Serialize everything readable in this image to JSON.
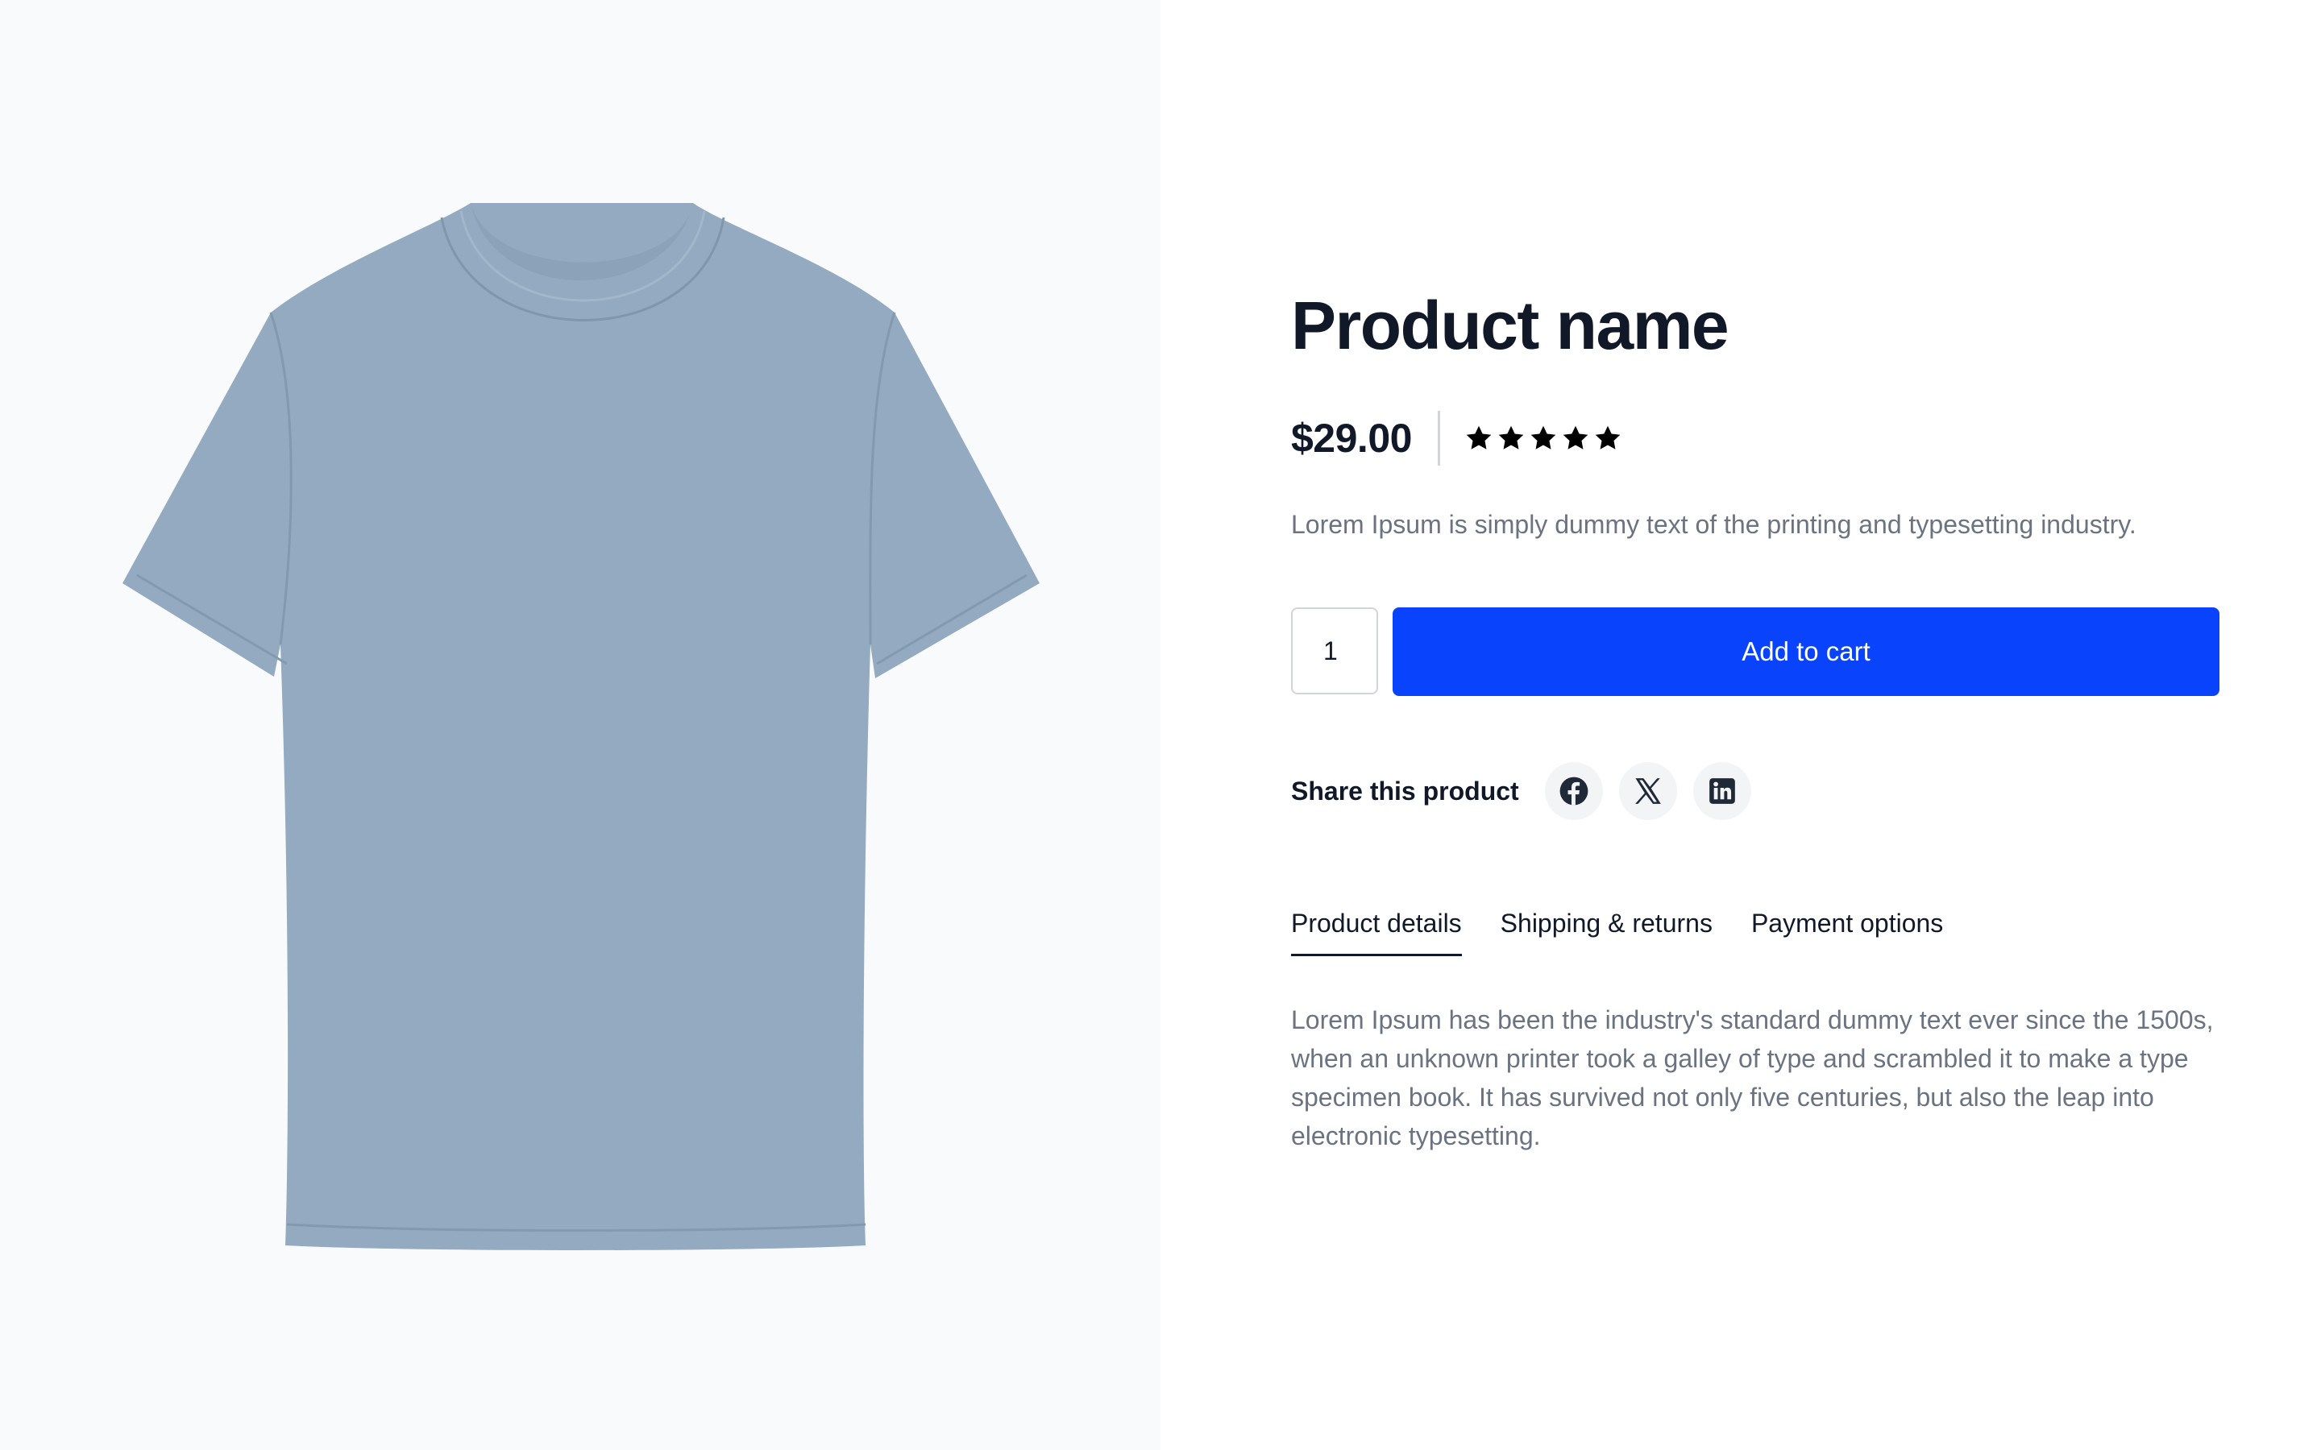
{
  "colors": {
    "accent": "#0943fb",
    "image_background": "#f9fafb",
    "heading": "#111827",
    "muted_text": "#6b7280",
    "tshirt": "#93aac0"
  },
  "product": {
    "image_icon": "blue-tshirt-image",
    "name": "Product name",
    "price": "$29.00",
    "rating": 5,
    "rating_max": 5,
    "short_description": "Lorem Ipsum is simply dummy text of the printing and typesetting industry."
  },
  "cart": {
    "quantity": "1",
    "add_label": "Add to cart"
  },
  "share": {
    "label": "Share this product",
    "networks": [
      {
        "name": "Facebook",
        "icon": "facebook-icon"
      },
      {
        "name": "X",
        "icon": "x-icon"
      },
      {
        "name": "LinkedIn",
        "icon": "linkedin-icon"
      }
    ]
  },
  "tabs": {
    "items": [
      {
        "label": "Product details",
        "active": true
      },
      {
        "label": "Shipping & returns",
        "active": false
      },
      {
        "label": "Payment options",
        "active": false
      }
    ],
    "content": "Lorem Ipsum has been the industry's standard dummy text ever since the 1500s, when an unknown printer took a galley of type and scrambled it to make a type specimen book. It has survived not only five centuries, but also the leap into electronic typesetting."
  }
}
